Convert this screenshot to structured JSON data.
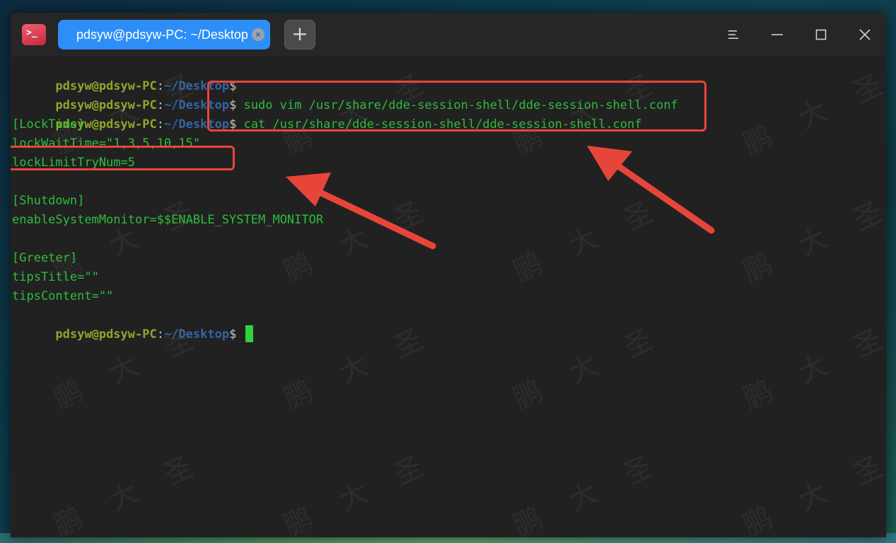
{
  "window": {
    "tab_title": "pdsyw@pdsyw-PC: ~/Desktop",
    "tab_close_symbol": "×",
    "new_tab_symbol": "+"
  },
  "icons": {
    "app": "terminal-icon",
    "menu": "hamburger-menu-icon",
    "minimize": "minimize-icon",
    "maximize": "maximize-icon",
    "close": "close-icon"
  },
  "prompt": {
    "user": "pdsyw@pdsyw-PC",
    "colon": ":",
    "path": "~/Desktop",
    "dollar": "$"
  },
  "terminal": {
    "cmd1": " sudo vim /usr/share/dde-session-shell/dde-session-shell.conf",
    "cmd2": " cat /usr/share/dde-session-shell/dde-session-shell.conf",
    "out": [
      "[LockTime]",
      "lockWaitTime=\"1,3,5,10,15\"",
      "lockLimitTryNum=5",
      "",
      "[Shutdown]",
      "enableSystemMonitor=$$ENABLE_SYSTEM_MONITOR",
      "",
      "[Greeter]",
      "tipsTitle=\"\"",
      "tipsContent=\"\""
    ],
    "final_prompt_suffix": " "
  },
  "watermark_text": "鹏大圣",
  "colors": {
    "tab_active": "#2e8ef7",
    "prompt_user": "#8fa62c",
    "prompt_path": "#3465a4",
    "output_text": "#2fbc3d",
    "annotation": "#e8453a"
  }
}
